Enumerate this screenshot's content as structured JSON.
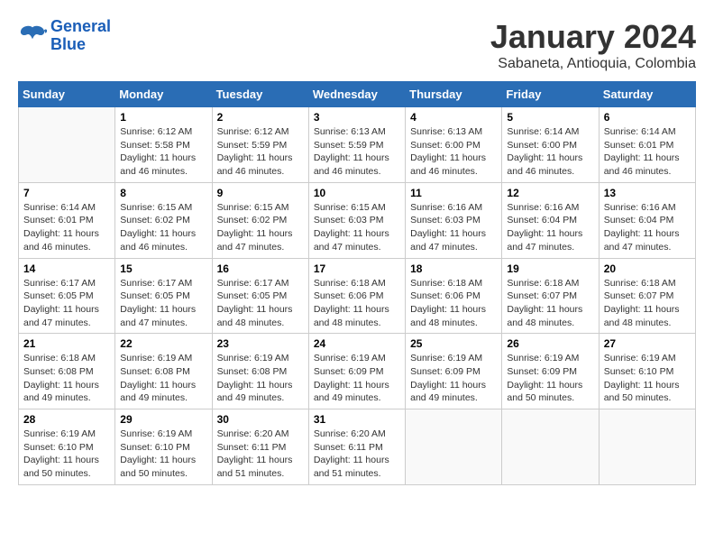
{
  "logo": {
    "line1": "General",
    "line2": "Blue"
  },
  "title": "January 2024",
  "subtitle": "Sabaneta, Antioquia, Colombia",
  "days_of_week": [
    "Sunday",
    "Monday",
    "Tuesday",
    "Wednesday",
    "Thursday",
    "Friday",
    "Saturday"
  ],
  "weeks": [
    [
      {
        "day": "",
        "info": ""
      },
      {
        "day": "1",
        "info": "Sunrise: 6:12 AM\nSunset: 5:58 PM\nDaylight: 11 hours\nand 46 minutes."
      },
      {
        "day": "2",
        "info": "Sunrise: 6:12 AM\nSunset: 5:59 PM\nDaylight: 11 hours\nand 46 minutes."
      },
      {
        "day": "3",
        "info": "Sunrise: 6:13 AM\nSunset: 5:59 PM\nDaylight: 11 hours\nand 46 minutes."
      },
      {
        "day": "4",
        "info": "Sunrise: 6:13 AM\nSunset: 6:00 PM\nDaylight: 11 hours\nand 46 minutes."
      },
      {
        "day": "5",
        "info": "Sunrise: 6:14 AM\nSunset: 6:00 PM\nDaylight: 11 hours\nand 46 minutes."
      },
      {
        "day": "6",
        "info": "Sunrise: 6:14 AM\nSunset: 6:01 PM\nDaylight: 11 hours\nand 46 minutes."
      }
    ],
    [
      {
        "day": "7",
        "info": "Sunrise: 6:14 AM\nSunset: 6:01 PM\nDaylight: 11 hours\nand 46 minutes."
      },
      {
        "day": "8",
        "info": "Sunrise: 6:15 AM\nSunset: 6:02 PM\nDaylight: 11 hours\nand 46 minutes."
      },
      {
        "day": "9",
        "info": "Sunrise: 6:15 AM\nSunset: 6:02 PM\nDaylight: 11 hours\nand 47 minutes."
      },
      {
        "day": "10",
        "info": "Sunrise: 6:15 AM\nSunset: 6:03 PM\nDaylight: 11 hours\nand 47 minutes."
      },
      {
        "day": "11",
        "info": "Sunrise: 6:16 AM\nSunset: 6:03 PM\nDaylight: 11 hours\nand 47 minutes."
      },
      {
        "day": "12",
        "info": "Sunrise: 6:16 AM\nSunset: 6:04 PM\nDaylight: 11 hours\nand 47 minutes."
      },
      {
        "day": "13",
        "info": "Sunrise: 6:16 AM\nSunset: 6:04 PM\nDaylight: 11 hours\nand 47 minutes."
      }
    ],
    [
      {
        "day": "14",
        "info": "Sunrise: 6:17 AM\nSunset: 6:05 PM\nDaylight: 11 hours\nand 47 minutes."
      },
      {
        "day": "15",
        "info": "Sunrise: 6:17 AM\nSunset: 6:05 PM\nDaylight: 11 hours\nand 47 minutes."
      },
      {
        "day": "16",
        "info": "Sunrise: 6:17 AM\nSunset: 6:05 PM\nDaylight: 11 hours\nand 48 minutes."
      },
      {
        "day": "17",
        "info": "Sunrise: 6:18 AM\nSunset: 6:06 PM\nDaylight: 11 hours\nand 48 minutes."
      },
      {
        "day": "18",
        "info": "Sunrise: 6:18 AM\nSunset: 6:06 PM\nDaylight: 11 hours\nand 48 minutes."
      },
      {
        "day": "19",
        "info": "Sunrise: 6:18 AM\nSunset: 6:07 PM\nDaylight: 11 hours\nand 48 minutes."
      },
      {
        "day": "20",
        "info": "Sunrise: 6:18 AM\nSunset: 6:07 PM\nDaylight: 11 hours\nand 48 minutes."
      }
    ],
    [
      {
        "day": "21",
        "info": "Sunrise: 6:18 AM\nSunset: 6:08 PM\nDaylight: 11 hours\nand 49 minutes."
      },
      {
        "day": "22",
        "info": "Sunrise: 6:19 AM\nSunset: 6:08 PM\nDaylight: 11 hours\nand 49 minutes."
      },
      {
        "day": "23",
        "info": "Sunrise: 6:19 AM\nSunset: 6:08 PM\nDaylight: 11 hours\nand 49 minutes."
      },
      {
        "day": "24",
        "info": "Sunrise: 6:19 AM\nSunset: 6:09 PM\nDaylight: 11 hours\nand 49 minutes."
      },
      {
        "day": "25",
        "info": "Sunrise: 6:19 AM\nSunset: 6:09 PM\nDaylight: 11 hours\nand 49 minutes."
      },
      {
        "day": "26",
        "info": "Sunrise: 6:19 AM\nSunset: 6:09 PM\nDaylight: 11 hours\nand 50 minutes."
      },
      {
        "day": "27",
        "info": "Sunrise: 6:19 AM\nSunset: 6:10 PM\nDaylight: 11 hours\nand 50 minutes."
      }
    ],
    [
      {
        "day": "28",
        "info": "Sunrise: 6:19 AM\nSunset: 6:10 PM\nDaylight: 11 hours\nand 50 minutes."
      },
      {
        "day": "29",
        "info": "Sunrise: 6:19 AM\nSunset: 6:10 PM\nDaylight: 11 hours\nand 50 minutes."
      },
      {
        "day": "30",
        "info": "Sunrise: 6:20 AM\nSunset: 6:11 PM\nDaylight: 11 hours\nand 51 minutes."
      },
      {
        "day": "31",
        "info": "Sunrise: 6:20 AM\nSunset: 6:11 PM\nDaylight: 11 hours\nand 51 minutes."
      },
      {
        "day": "",
        "info": ""
      },
      {
        "day": "",
        "info": ""
      },
      {
        "day": "",
        "info": ""
      }
    ]
  ]
}
